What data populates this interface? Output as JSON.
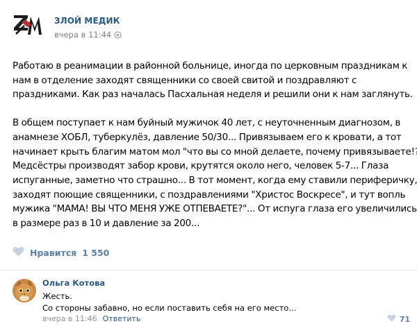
{
  "post": {
    "author": "ЗЛОЙ МЕДИК",
    "time": "вчера в 11:44",
    "paragraphs": [
      [
        "Работаю в реанимации в районной больнице, иногда по церковным праздникам к",
        "нам в отделение заходят священники со своей свитой и поздравляют с",
        "праздниками. Как раз началась Пасхальная неделя и решили они к нам заглянуть."
      ],
      [
        "В общем поступает к нам буйный мужичок 40 лет, с неуточненным диагнозом, в",
        "анамнезе ХОБЛ, туберкулёз, давление 50/30... Привязываем его к кровати, а тот",
        "начинает крыть благим матом мол \"что вы со мной делаете, почему привязываете!?\"",
        "Медсёстры производят забор крови, крутятся около него, человек 5-7... Глаза",
        "испуганные, заметно что страшно... В тот момент, когда ему ставили периферичку,",
        "заходят поющие священники, с поздравлениями \"Христос Воскресе\", и тут вопль",
        "мужика \"МАМА! ВЫ ЧТО МЕНЯ УЖЕ ОТПЕВАЕТЕ?\"... От испуга глаза его увеличились",
        "в размере раз в 10 и давление за 200..."
      ]
    ],
    "likes_label": "Нравится",
    "likes_count": "1 550"
  },
  "comment": {
    "author": "Ольга Котова",
    "lines": [
      "Жесть.",
      "Со стороны забавно, но если поставить себя на его место..."
    ],
    "time": "вчера в 11:46",
    "reply_label": "Ответить",
    "likes_count": "71"
  },
  "colors": {
    "link": "#2a5885",
    "like": "#5b7fa6",
    "meta": "#828282",
    "logo_red": "#b8322b",
    "logo_dark": "#1c1c1c"
  },
  "icons": [
    "logo-icon",
    "eye-icon",
    "heart-icon",
    "cat-avatar"
  ]
}
